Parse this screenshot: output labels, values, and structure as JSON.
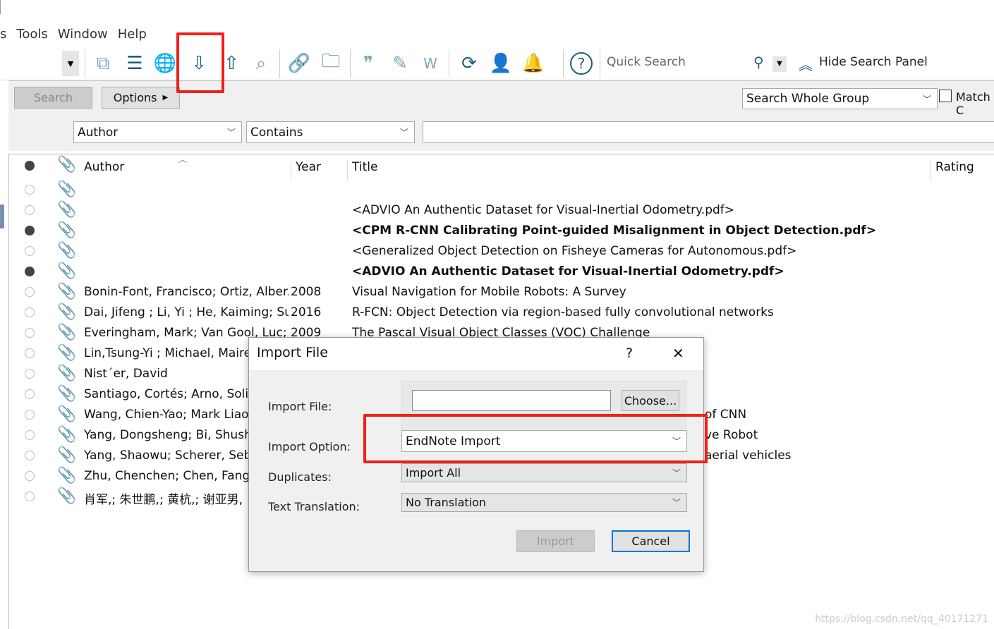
{
  "menu": [
    "s",
    "Tools",
    "Window",
    "Help"
  ],
  "toolbar": {
    "icons": [
      "dropdown-icon",
      "new-group-icon",
      "new-reference-icon",
      "online-search-icon",
      "import-icon",
      "export-icon",
      "find-pdf-icon",
      "open-link-icon",
      "open-file-icon",
      "cite-icon",
      "format-bibliography-icon",
      "word-icon",
      "sync-icon",
      "share-icon",
      "notify-icon",
      "help-icon"
    ],
    "quick_search": "Quick Search",
    "hide_search": "Hide Search Panel"
  },
  "search": {
    "search_btn": "Search",
    "options_btn": "Options",
    "scope": "Search Whole Group",
    "match_case": "Match C",
    "field": "Author",
    "operator": "Contains",
    "value": ""
  },
  "columns": {
    "author": "Author",
    "year": "Year",
    "title": "Title",
    "rating": "Rating"
  },
  "rows": [
    {
      "read": false,
      "author": "",
      "year": "",
      "title": "",
      "bold": false
    },
    {
      "read": false,
      "author": "",
      "year": "",
      "title": "<ADVIO An Authentic Dataset for Visual-Inertial Odometry.pdf>",
      "bold": false
    },
    {
      "read": true,
      "author": "",
      "year": "",
      "title": "<CPM R-CNN Calibrating Point-guided Misalignment in Object Detection.pdf>",
      "bold": true
    },
    {
      "read": false,
      "author": "",
      "year": "",
      "title": "<Generalized Object Detection on Fisheye Cameras for Autonomous.pdf>",
      "bold": false
    },
    {
      "read": true,
      "author": "",
      "year": "",
      "title": "<ADVIO An Authentic Dataset for Visual-Inertial Odometry.pdf>",
      "bold": true
    },
    {
      "read": false,
      "author": "Bonin-Font, Francisco; Ortiz, Alber...",
      "year": "2008",
      "title": "Visual Navigation for Mobile Robots: A Survey",
      "bold": false
    },
    {
      "read": false,
      "author": "Dai, Jifeng ; Li, Yi ; He, Kaiming; Su...",
      "year": "2016",
      "title": "R-FCN: Object Detection via region-based fully convolutional networks",
      "bold": false
    },
    {
      "read": false,
      "author": "Everingham, Mark; Van Gool, Luc; ...",
      "year": "2009",
      "title": "The Pascal Visual Object Classes (VOC) Challenge",
      "bold": false
    },
    {
      "read": false,
      "author": "Lin,Tsung-Yi ; Michael, Maire; S",
      "year": "",
      "title": "",
      "bold": false
    },
    {
      "read": false,
      "author": "Nist´er, David",
      "year": "",
      "title": "",
      "bold": false
    },
    {
      "read": false,
      "author": "Santiago,  Cortés; Arno, Solin;",
      "year": "",
      "title": "",
      "bold": false
    },
    {
      "read": false,
      "author": "Wang, Chien-Yao; Mark Liao, H",
      "year": "",
      "title": "of CNN",
      "bold": false
    },
    {
      "read": false,
      "author": "Yang, Dongsheng; Bi, Shusher",
      "year": "",
      "title": "ve Robot",
      "bold": false
    },
    {
      "read": false,
      "author": "Yang, Shaowu; Scherer, Sebas",
      "year": "",
      "title": "aerial vehicles",
      "bold": false
    },
    {
      "read": false,
      "author": "Zhu, Chenchen; Chen, Fangyi;",
      "year": "",
      "title": "",
      "bold": false
    },
    {
      "read": false,
      "author": "肖军,; 朱世鹏,; 黄杭,; 谢亚男,",
      "year": "",
      "title": "",
      "bold": false
    }
  ],
  "dialog": {
    "title": "Import File",
    "help": "?",
    "close": "✕",
    "import_file_label": "Import File:",
    "import_file_value": "",
    "choose": "Choose...",
    "import_option_label": "Import Option:",
    "import_option": "EndNote Import",
    "duplicates_label": "Duplicates:",
    "duplicates": "Import All",
    "translation_label": "Text Translation:",
    "translation": "No Translation",
    "import_btn": "Import",
    "cancel_btn": "Cancel"
  },
  "highlight_color": "#f0201a",
  "watermark": "https://blog.csdn.net/qq_40171271"
}
